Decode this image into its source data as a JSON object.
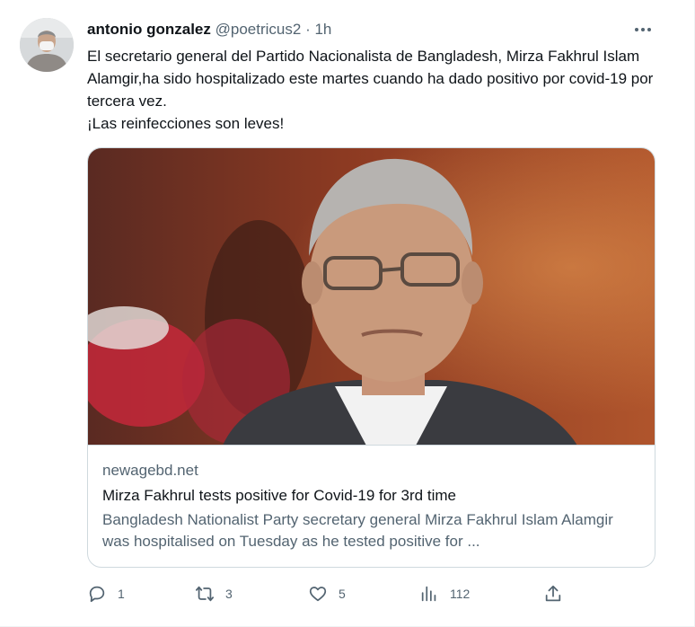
{
  "tweet": {
    "author_name": "antonio gonzalez",
    "author_handle": "@poetricus2",
    "separator": "·",
    "time": "1h",
    "more_icon": "more-horizontal-icon",
    "paragraphs": [
      "El secretario general del Partido Nacionalista de Bangladesh, Mirza Fakhrul Islam Alamgir,ha sido hospitalizado este martes cuando ha dado positivo por covid-19 por tercera vez.",
      "¡Las reinfecciones son leves!"
    ]
  },
  "card": {
    "domain": "newagebd.net",
    "title": "Mirza Fakhrul tests positive for Covid-19 for 3rd time",
    "description": "Bangladesh Nationalist Party secretary general Mirza Fakhrul Islam Alamgir was hospitalised on Tuesday as he tested positive for ..."
  },
  "actions": {
    "reply": {
      "icon": "reply-icon",
      "count": "1"
    },
    "retweet": {
      "icon": "retweet-icon",
      "count": "3"
    },
    "like": {
      "icon": "heart-icon",
      "count": "5"
    },
    "views": {
      "icon": "views-icon",
      "count": "112"
    },
    "share": {
      "icon": "share-icon"
    }
  },
  "colors": {
    "text_primary": "#0f1419",
    "text_secondary": "#536471",
    "border": "#cfd9de"
  }
}
